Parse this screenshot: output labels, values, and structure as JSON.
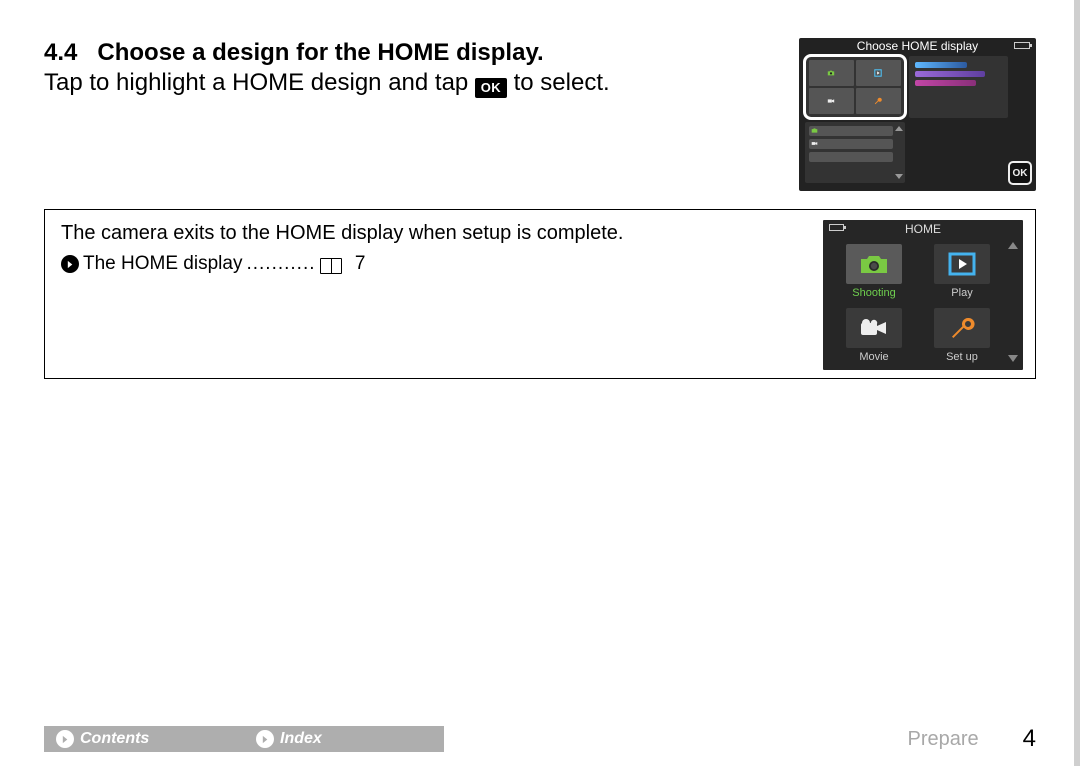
{
  "step": {
    "number": "4.4",
    "title": "Choose a design for the HOME display.",
    "body_before_ok": "Tap to highlight a HOME design and tap",
    "body_after_ok": "to select.",
    "ok_label": "OK"
  },
  "figure1": {
    "title": "Choose HOME display",
    "ok_label": "OK"
  },
  "note": {
    "text": "The camera exits to the HOME display when setup is complete.",
    "link_label": "The HOME display",
    "link_dots": "...........",
    "page_ref": "7"
  },
  "figure2": {
    "title": "HOME",
    "items": [
      {
        "label": "Shooting",
        "active": true
      },
      {
        "label": "Play",
        "active": false
      },
      {
        "label": "Movie",
        "active": false
      },
      {
        "label": "Set up",
        "active": false
      }
    ]
  },
  "footer": {
    "contents": "Contents",
    "index": "Index",
    "section": "Prepare",
    "page": "4"
  }
}
